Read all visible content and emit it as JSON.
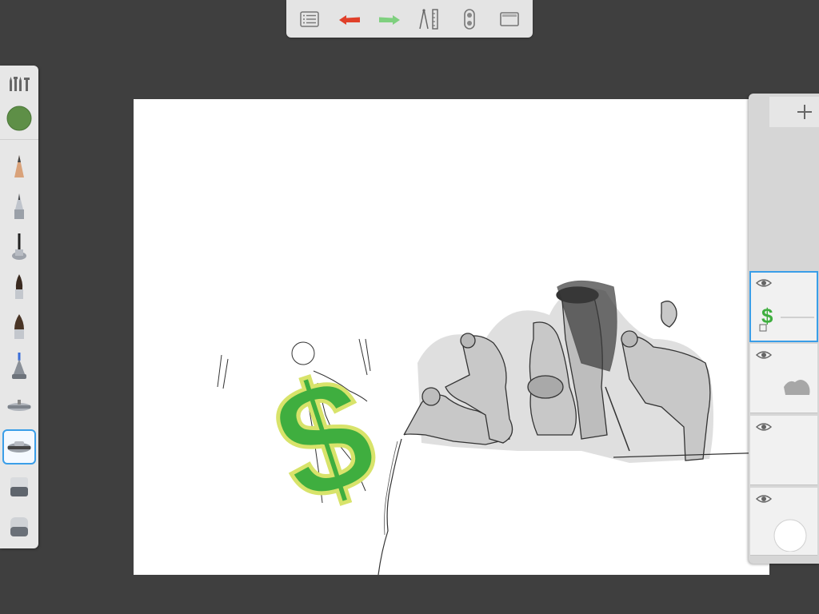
{
  "app": {
    "top_toolbar": [
      "layer-list-button",
      "undo-button",
      "redo-button",
      "guides-button",
      "symmetry-button",
      "fullscreen-button"
    ],
    "colors": {
      "undo": "#e0402a",
      "redo": "#7fd07f",
      "current_color": "#5e8f47",
      "selection": "#3a9ee8"
    }
  },
  "tools": {
    "current_color": "#5e8f47",
    "items": [
      "pencil",
      "ballpoint-pen",
      "fine-brush",
      "marker",
      "chisel-marker",
      "airbrush",
      "smudge-tool",
      "flat-brush",
      "soft-eraser",
      "hard-eraser"
    ],
    "selected": "flat-brush"
  },
  "layers": {
    "count": 4,
    "active_index": 0
  }
}
